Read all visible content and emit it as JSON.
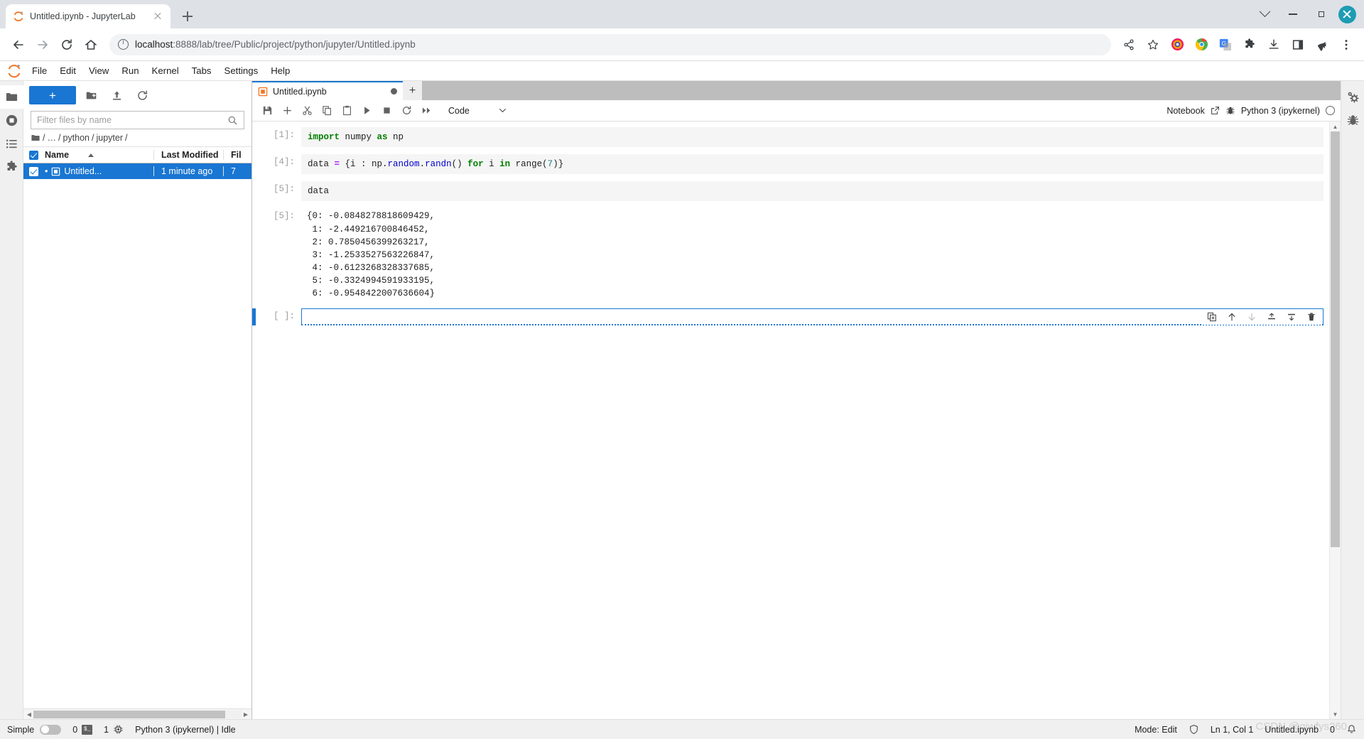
{
  "browser": {
    "tab": {
      "title": "Untitled.ipynb - JupyterLab",
      "favicon": "jupyter-favicon"
    },
    "new_tab_label": "+",
    "window_controls": [
      "chevron-down",
      "minimize",
      "maximize",
      "close"
    ],
    "nav": {
      "back": "←",
      "forward": "→",
      "reload": "⟳",
      "home": "⌂"
    },
    "url_prefix": "localhost",
    "url_rest": ":8888/lab/tree/Public/project/python/jupyter/Untitled.ipynb",
    "toolbar_icons": [
      "share-icon",
      "bookmark-star-icon",
      "profile-icon",
      "chrome-icon",
      "translate-icon",
      "extensions-puzzle-icon",
      "download-icon",
      "sidepanel-icon",
      "pin-icon",
      "more-vert-icon"
    ]
  },
  "menubar": {
    "logo": "jupyter-logo",
    "items": [
      "File",
      "Edit",
      "View",
      "Run",
      "Kernel",
      "Tabs",
      "Settings",
      "Help"
    ]
  },
  "left_sidebar": {
    "items": [
      {
        "name": "file-browser",
        "icon": "folder-icon",
        "active": true
      },
      {
        "name": "running-terminals-kernels",
        "icon": "stop-circle-icon",
        "active": false
      },
      {
        "name": "commands",
        "icon": "list-icon",
        "active": false
      },
      {
        "name": "extension-manager",
        "icon": "puzzle-icon",
        "active": false
      }
    ]
  },
  "right_sidebar": {
    "items": [
      {
        "name": "property-inspector",
        "icon": "gears-icon"
      },
      {
        "name": "debugger",
        "icon": "bug-icon"
      }
    ]
  },
  "filebrowser": {
    "new_button_label": "+",
    "toolbar_icons": [
      "new-folder-icon",
      "upload-icon",
      "refresh-icon"
    ],
    "filter_placeholder": "Filter files by name",
    "filter_value": "",
    "breadcrumbs": [
      "/",
      "…",
      "python",
      "jupyter",
      ""
    ],
    "columns": {
      "name": "Name",
      "last_modified": "Last Modified",
      "file_size": "Fil"
    },
    "rows": [
      {
        "name": "Untitled...",
        "last_modified": "1 minute ago",
        "size": "7",
        "selected": true,
        "icon": "notebook-icon",
        "dirty_dot": "•"
      }
    ]
  },
  "notebook": {
    "tab_title": "Untitled.ipynb",
    "tab_icon": "notebook-icon",
    "tab_dirty_indicator": "●",
    "add_tab_label": "+",
    "toolbar_icons": [
      "save-icon",
      "insert-cell-icon",
      "cut-icon",
      "copy-icon",
      "paste-icon",
      "run-icon",
      "stop-icon",
      "restart-icon",
      "restart-run-all-icon"
    ],
    "cell_type": "Code",
    "cell_type_caret": "chevron-down-icon",
    "right_label": "Notebook",
    "right_launch_icon": "external-link-icon",
    "debug_icon": "bug-icon",
    "kernel_name": "Python 3 (ipykernel)",
    "kernel_status_icon": "idle-circle-icon",
    "cells": [
      {
        "prompt": "[1]:",
        "type": "code",
        "tokens": [
          {
            "t": "import",
            "c": "kw"
          },
          {
            "t": " numpy ",
            "c": ""
          },
          {
            "t": "as",
            "c": "kw"
          },
          {
            "t": " np",
            "c": ""
          }
        ]
      },
      {
        "prompt": "[4]:",
        "type": "code",
        "tokens": [
          {
            "t": "data ",
            "c": ""
          },
          {
            "t": "=",
            "c": "op"
          },
          {
            "t": " {i : np.",
            "c": ""
          },
          {
            "t": "random",
            "c": "attr"
          },
          {
            "t": ".",
            "c": ""
          },
          {
            "t": "randn",
            "c": "attr"
          },
          {
            "t": "() ",
            "c": ""
          },
          {
            "t": "for",
            "c": "kw"
          },
          {
            "t": " i ",
            "c": ""
          },
          {
            "t": "in",
            "c": "kw"
          },
          {
            "t": " range(",
            "c": ""
          },
          {
            "t": "7",
            "c": "num"
          },
          {
            "t": ")}",
            "c": ""
          }
        ]
      },
      {
        "prompt": "[5]:",
        "type": "code",
        "tokens": [
          {
            "t": "data",
            "c": ""
          }
        ]
      },
      {
        "prompt": "[5]:",
        "type": "output",
        "text": "{0: -0.0848278818609429,\n 1: -2.449216700846452,\n 2: 0.7850456399263217,\n 3: -1.2533527563226847,\n 4: -0.6123268328337685,\n 5: -0.3324994591933195,\n 6: -0.9548422007636604}"
      },
      {
        "prompt": "[ ]:",
        "type": "code-active",
        "value": "",
        "cell_tools": [
          "duplicate-cell-icon",
          "move-cell-up-icon",
          "move-cell-down-icon",
          "insert-cell-above-icon",
          "insert-cell-below-icon",
          "delete-cell-icon"
        ]
      }
    ]
  },
  "statusbar": {
    "simple_label": "Simple",
    "simple_toggle_on": false,
    "terminals_count": "0",
    "terminal_icon": "terminal-icon",
    "kernels_count": "1",
    "kernel_icon": "kernel-chip-icon",
    "kernel_status": "Python 3 (ipykernel) | Idle",
    "mode": "Mode: Edit",
    "shield_icon": "shield-icon",
    "cursor_position": "Ln 1, Col 1",
    "file_name": "Untitled.ipynb",
    "notification_count": "0",
    "bell_icon": "bell-icon",
    "watermark": "CSDN @qiwfys260"
  },
  "colors": {
    "accent": "#1976d2",
    "jupyter_orange": "#f37726",
    "cell_bg": "#f5f5f5",
    "keyword_green": "#008000",
    "operator_purple": "#aa22ff",
    "attr_blue": "#0000cc",
    "number_teal": "#1a7a7a"
  }
}
